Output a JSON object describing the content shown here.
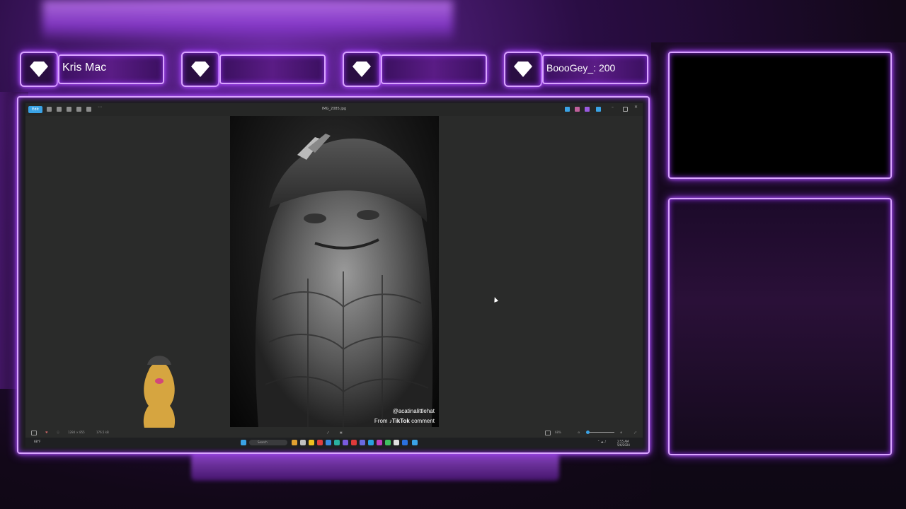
{
  "overlay": {
    "alerts": [
      {
        "name": ""
      },
      {
        "name": ""
      },
      {
        "name": ""
      },
      {
        "name": ""
      }
    ],
    "recent_follower": "Kris Mac",
    "top_donor": "BoooGey_: 200"
  },
  "viewer": {
    "window_title": "IMG_2085.jpg",
    "edit_label": "Edit",
    "photo_credit_handle": "@acatinalittlehat",
    "photo_credit_from": "From",
    "photo_credit_brand": "TikTok",
    "photo_credit_suffix": "comment",
    "status_dimensions": "1284 × 855",
    "status_size": "176.5 kB",
    "zoom_level": "68%"
  },
  "taskbar": {
    "search_placeholder": "Search",
    "weather": "68°F",
    "time": "2:55 AM",
    "date": "5/6/2024"
  },
  "colors": {
    "neon": "#d9a4ff",
    "accent": "#3aa3e6",
    "photo_bg": "#1a1a1a"
  },
  "icons": [
    "diamond-icon",
    "rotate-icon",
    "delete-icon",
    "print-icon",
    "share-icon",
    "more-icon",
    "zoom-in-icon",
    "zoom-out-icon",
    "fullscreen-icon",
    "windows-icon",
    "search-icon"
  ]
}
